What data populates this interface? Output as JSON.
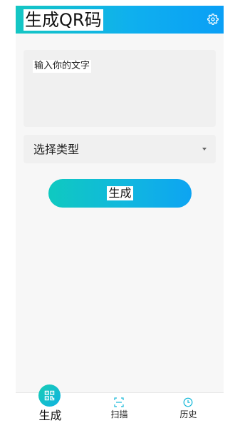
{
  "app": {
    "title": "生成QR码",
    "accent_start": "#14c6c3",
    "accent_end": "#0a9ff6"
  },
  "header": {
    "settings_icon": "gear-icon"
  },
  "form": {
    "text_placeholder": "输入你的文字",
    "type_select": {
      "selected": "选择类型",
      "icon": "caret-down-icon"
    },
    "generate_button": "生成"
  },
  "bottom_nav": {
    "items": [
      {
        "label": "生成",
        "icon": "qr-code-icon",
        "active": true
      },
      {
        "label": "扫描",
        "icon": "scan-frame-icon",
        "active": false
      },
      {
        "label": "历史",
        "icon": "clock-icon",
        "active": false
      }
    ]
  }
}
